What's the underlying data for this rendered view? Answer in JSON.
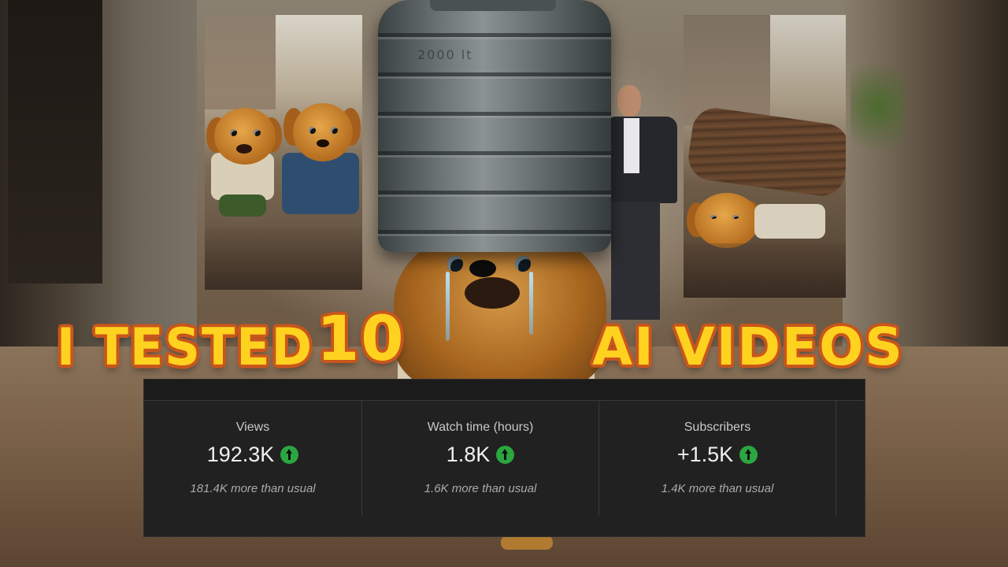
{
  "thumbnail_title": {
    "part1": "I TESTED",
    "part2": "10",
    "part3": "AI VIDEOS"
  },
  "tank_marking": "2000 lt",
  "colors": {
    "title_fill": "#ffd21f",
    "title_outline": "#c8561c",
    "panel_bg": "#212121",
    "up_arrow_green": "#2ba640"
  },
  "analytics": {
    "cards": [
      {
        "label": "Views",
        "value": "192.3K",
        "trend_icon": "arrow-up-icon",
        "comparison": "181.4K more than usual"
      },
      {
        "label": "Watch time (hours)",
        "value": "1.8K",
        "trend_icon": "arrow-up-icon",
        "comparison": "1.6K more than usual"
      },
      {
        "label": "Subscribers",
        "value": "+1.5K",
        "trend_icon": "arrow-up-icon",
        "comparison": "1.4K more than usual"
      }
    ]
  }
}
